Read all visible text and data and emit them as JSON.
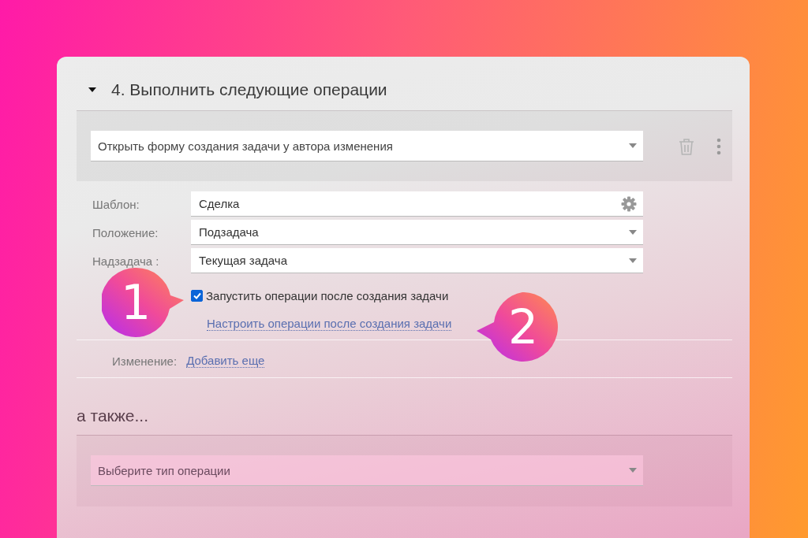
{
  "section": {
    "title": "4. Выполнить следующие операции",
    "expanded": true
  },
  "operation": {
    "value": "Открыть форму создания задачи у автора изменения"
  },
  "fields": [
    {
      "kind": "text",
      "label": "Шаблон:",
      "value": "Сделка"
    },
    {
      "kind": "select",
      "label": "Положение:",
      "value": "Подзадача"
    },
    {
      "kind": "select",
      "label": "Надзадача :",
      "value": "Текущая задача"
    }
  ],
  "run_after": {
    "label": "Запустить операции после создания задачи",
    "checked": true
  },
  "configure_link": "Настроить операции после создания задачи",
  "change": {
    "label": "Изменение:",
    "link": "Добавить еще"
  },
  "also": {
    "title": "а также...",
    "placeholder": "Выберите тип операции"
  },
  "callouts": [
    "1",
    "2"
  ]
}
